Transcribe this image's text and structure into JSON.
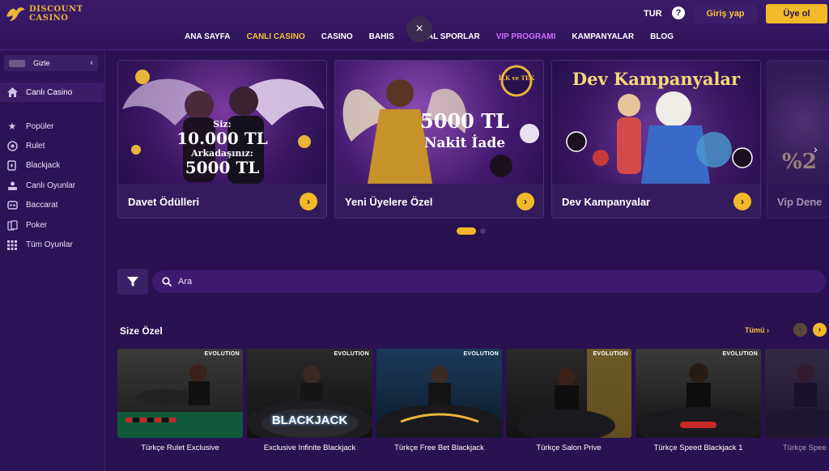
{
  "brand": {
    "line1": "DISCOUNT",
    "line2": "CASINO",
    "accent": "#e8b43a"
  },
  "header": {
    "nav": [
      {
        "label": "ANA SAYFA",
        "state": "normal"
      },
      {
        "label": "CANLI CASINO",
        "state": "active"
      },
      {
        "label": "CASINO",
        "state": "normal"
      },
      {
        "label": "BAHIS",
        "state": "normal"
      },
      {
        "label": "SANAL SPORLAR",
        "state": "normal"
      },
      {
        "label": "VIP PROGRAMI",
        "state": "vip"
      },
      {
        "label": "KAMPANYALAR",
        "state": "normal"
      },
      {
        "label": "BLOG",
        "state": "normal"
      }
    ],
    "close_icon": "×",
    "language": "TUR",
    "help_icon": "?",
    "login_label": "Giriş yap",
    "signup_label": "Üye ol"
  },
  "sidebar": {
    "hide_label": "Gizle",
    "main_item": "Canlı Casino",
    "items": [
      {
        "label": "Popüler",
        "icon": "star-icon"
      },
      {
        "label": "Rulet",
        "icon": "roulette-icon"
      },
      {
        "label": "Blackjack",
        "icon": "cards-icon"
      },
      {
        "label": "Canlı Oyunlar",
        "icon": "dealer-icon"
      },
      {
        "label": "Baccarat",
        "icon": "baccarat-icon"
      },
      {
        "label": "Poker",
        "icon": "poker-icon"
      },
      {
        "label": "Tüm Oyunlar",
        "icon": "grid-icon"
      }
    ]
  },
  "promos": [
    {
      "title": "Davet Ödülleri",
      "art_line1": "Siz:",
      "art_line2": "10.000 TL",
      "art_line3": "Arkadaşınız:",
      "art_line4": "5000 TL"
    },
    {
      "title": "Yeni Üyelere Özel",
      "art_badge": "İLK ve TEK",
      "art_line1": "5000 TL",
      "art_line2": "Nakit İade"
    },
    {
      "title": "Dev Kampanyalar",
      "art_line1": "Dev Kampanyalar"
    },
    {
      "title": "Vip Dene",
      "art_line1": "%2"
    }
  ],
  "search": {
    "placeholder": "Ara"
  },
  "section": {
    "title": "Size Özel",
    "all_label": "Tümü",
    "games": [
      {
        "name": "Türkçe Rulet Exclusive",
        "badge": "EVOLUTION"
      },
      {
        "name": "Exclusive Infinite Blackjack",
        "badge": "EVOLUTION",
        "logo": "BLACKJACK"
      },
      {
        "name": "Türkçe Free Bet Blackjack",
        "badge": "EVOLUTION"
      },
      {
        "name": "Türkçe Salon Prive",
        "badge": "EVOLUTION"
      },
      {
        "name": "Türkçe Speed Blackjack 1",
        "badge": "EVOLUTION"
      },
      {
        "name": "Türkçe Spee",
        "badge": ""
      }
    ]
  }
}
